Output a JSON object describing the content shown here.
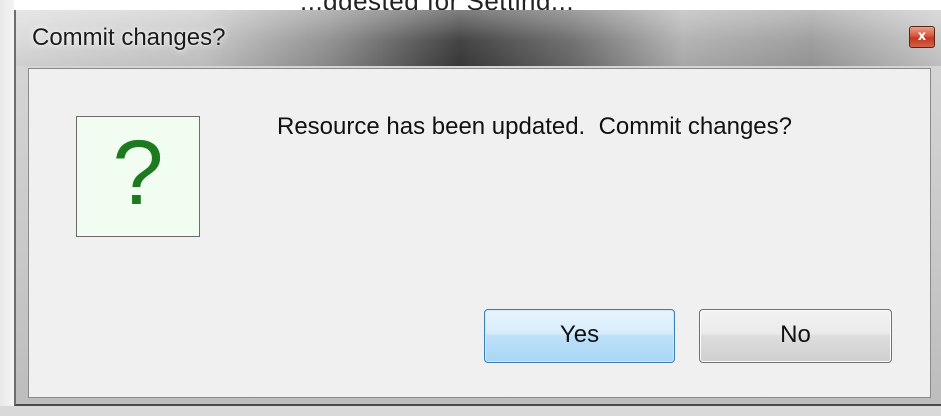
{
  "background_window": {
    "partial_text": "...ggested for Setting..."
  },
  "dialog": {
    "title": "Commit changes?",
    "close_glyph": "x",
    "icon": "question-mark-icon",
    "icon_glyph": "?",
    "message": "Resource has been updated.  Commit changes?",
    "buttons": {
      "yes_label": "Yes",
      "no_label": "No"
    }
  },
  "colors": {
    "icon_green": "#1e7a1e",
    "icon_background": "#f2fdf2",
    "close_red": "#c2391e",
    "default_button_blue": "#a8d6f6"
  }
}
